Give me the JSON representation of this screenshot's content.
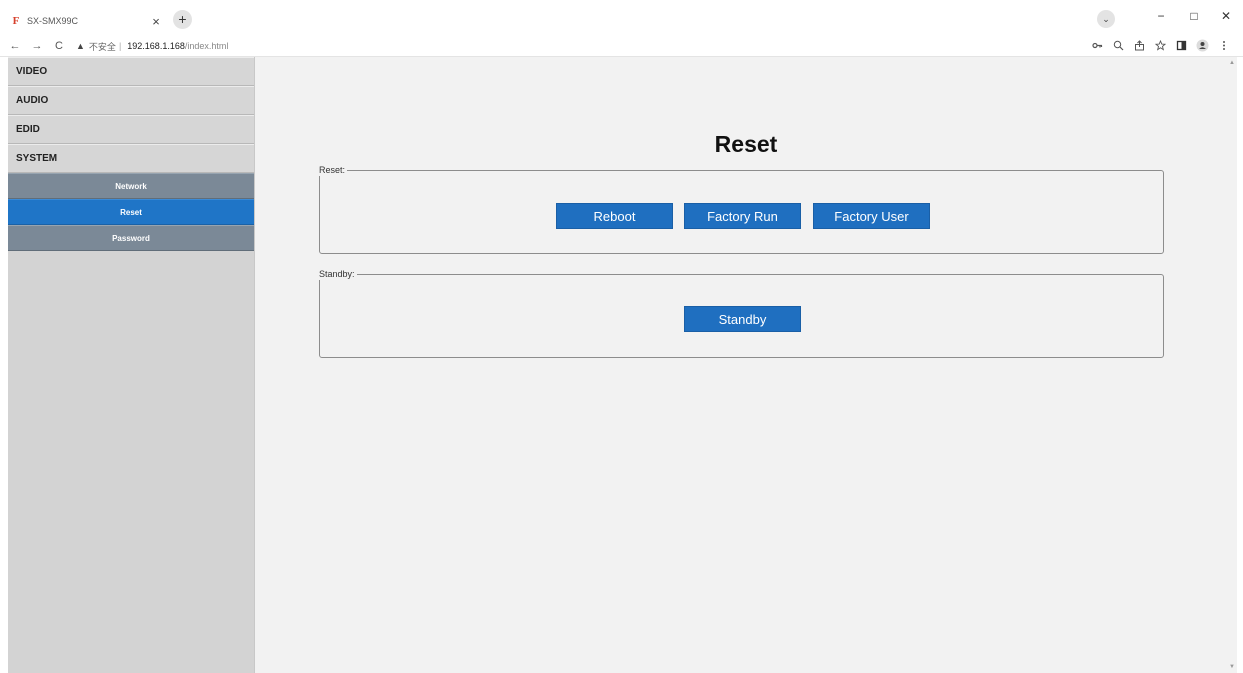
{
  "browser": {
    "tab_favicon": "F",
    "tab_title": "SX-SMX99C",
    "tab_close": "×",
    "new_tab": "+",
    "tab_search": "⌄",
    "window_controls": [
      "−",
      "□",
      "✕"
    ],
    "nav": {
      "back": "←",
      "forward": "→",
      "reload": "C"
    },
    "security_icon": "▲",
    "security_label": "不安全",
    "url_separator": "|",
    "url_host": "192.168.1.168",
    "url_path": "/index.html",
    "toolbar_icons": [
      "key-icon",
      "zoom-icon",
      "share-icon",
      "star-icon",
      "sidepanel-icon",
      "profile-icon",
      "menu-icon"
    ]
  },
  "sidebar": {
    "main_items": [
      {
        "label": "VIDEO"
      },
      {
        "label": "AUDIO"
      },
      {
        "label": "EDID"
      },
      {
        "label": "SYSTEM"
      }
    ],
    "sub_items": [
      {
        "label": "Network",
        "active": false
      },
      {
        "label": "Reset",
        "active": true
      },
      {
        "label": "Password",
        "active": false
      }
    ]
  },
  "main": {
    "title": "Reset",
    "reset_group": {
      "legend": "Reset:",
      "buttons": [
        {
          "label": "Reboot"
        },
        {
          "label": "Factory Run"
        },
        {
          "label": "Factory User"
        }
      ]
    },
    "standby_group": {
      "legend": "Standby:",
      "button": "Standby"
    }
  },
  "colors": {
    "accent": "#1f6fc0",
    "active_menu": "#1f75c7",
    "sub_menu": "#7b8997",
    "sidebar_bg": "#d3d3d3",
    "content_bg": "#f2f2f2"
  }
}
